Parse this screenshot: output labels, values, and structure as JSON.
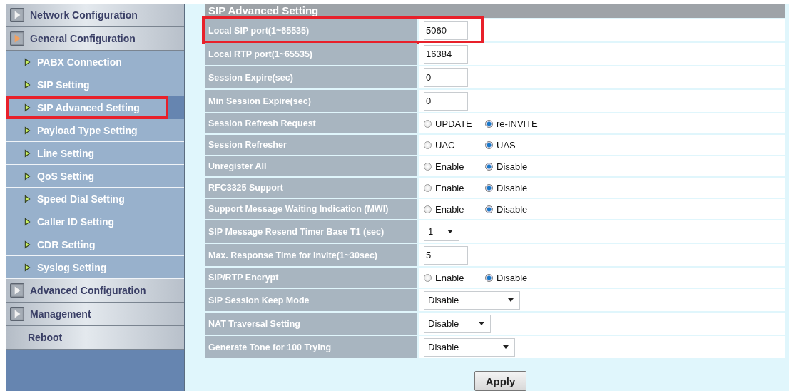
{
  "sidebar": {
    "items": [
      {
        "label": "Network Configuration",
        "expanded": false
      },
      {
        "label": "General Configuration",
        "expanded": true,
        "children": [
          {
            "label": "PABX Connection",
            "highlighted": false
          },
          {
            "label": "SIP Setting",
            "highlighted": false
          },
          {
            "label": "SIP Advanced Setting",
            "highlighted": true
          },
          {
            "label": "Payload Type Setting",
            "highlighted": false
          },
          {
            "label": "Line Setting",
            "highlighted": false
          },
          {
            "label": "QoS Setting",
            "highlighted": false
          },
          {
            "label": "Speed Dial Setting",
            "highlighted": false
          },
          {
            "label": "Caller ID Setting",
            "highlighted": false
          },
          {
            "label": "CDR Setting",
            "highlighted": false
          },
          {
            "label": "Syslog Setting",
            "highlighted": false
          }
        ]
      },
      {
        "label": "Advanced Configuration",
        "expanded": false
      },
      {
        "label": "Management",
        "expanded": false
      },
      {
        "label": "Reboot",
        "kind": "plain"
      }
    ]
  },
  "panel": {
    "title": "SIP Advanced Setting",
    "rows": [
      {
        "label": "Local SIP port(1~65535)",
        "kind": "text",
        "value": "5060",
        "highlighted": true
      },
      {
        "label": "Local RTP port(1~65535)",
        "kind": "text",
        "value": "16384",
        "highlighted": false
      },
      {
        "label": "Session Expire(sec)",
        "kind": "text",
        "value": "0",
        "highlighted": false
      },
      {
        "label": "Min Session Expire(sec)",
        "kind": "text",
        "value": "0",
        "highlighted": false
      },
      {
        "label": "Session Refresh Request",
        "kind": "radio",
        "options": [
          {
            "label": "UPDATE",
            "selected": false
          },
          {
            "label": "re-INVITE",
            "selected": true
          }
        ],
        "highlighted": false
      },
      {
        "label": "Session Refresher",
        "kind": "radio",
        "options": [
          {
            "label": "UAC",
            "selected": false
          },
          {
            "label": "UAS",
            "selected": true
          }
        ],
        "highlighted": false
      },
      {
        "label": "Unregister All",
        "kind": "radio",
        "options": [
          {
            "label": "Enable",
            "selected": false
          },
          {
            "label": "Disable",
            "selected": true
          }
        ],
        "highlighted": false
      },
      {
        "label": "RFC3325 Support",
        "kind": "radio",
        "options": [
          {
            "label": "Enable",
            "selected": false
          },
          {
            "label": "Disable",
            "selected": true
          }
        ],
        "highlighted": false
      },
      {
        "label": "Support Message Waiting Indication (MWI)",
        "kind": "radio",
        "options": [
          {
            "label": "Enable",
            "selected": false
          },
          {
            "label": "Disable",
            "selected": true
          }
        ],
        "highlighted": false
      },
      {
        "label": "SIP Message Resend Timer Base T1 (sec)",
        "kind": "select",
        "value": "1",
        "highlighted": false
      },
      {
        "label": "Max. Response Time for Invite(1~30sec)",
        "kind": "text",
        "value": "5",
        "highlighted": false
      },
      {
        "label": "SIP/RTP Encrypt",
        "kind": "radio",
        "options": [
          {
            "label": "Enable",
            "selected": false
          },
          {
            "label": "Disable",
            "selected": true
          }
        ],
        "highlighted": false
      },
      {
        "label": "SIP Session Keep Mode",
        "kind": "select",
        "value": "Disable",
        "highlighted": false
      },
      {
        "label": "NAT Traversal Setting",
        "kind": "select",
        "value": "Disable",
        "highlighted": false
      },
      {
        "label": "Generate Tone for 100 Trying",
        "kind": "select",
        "value": "Disable",
        "highlighted": false
      }
    ],
    "apply_button": "Apply"
  }
}
